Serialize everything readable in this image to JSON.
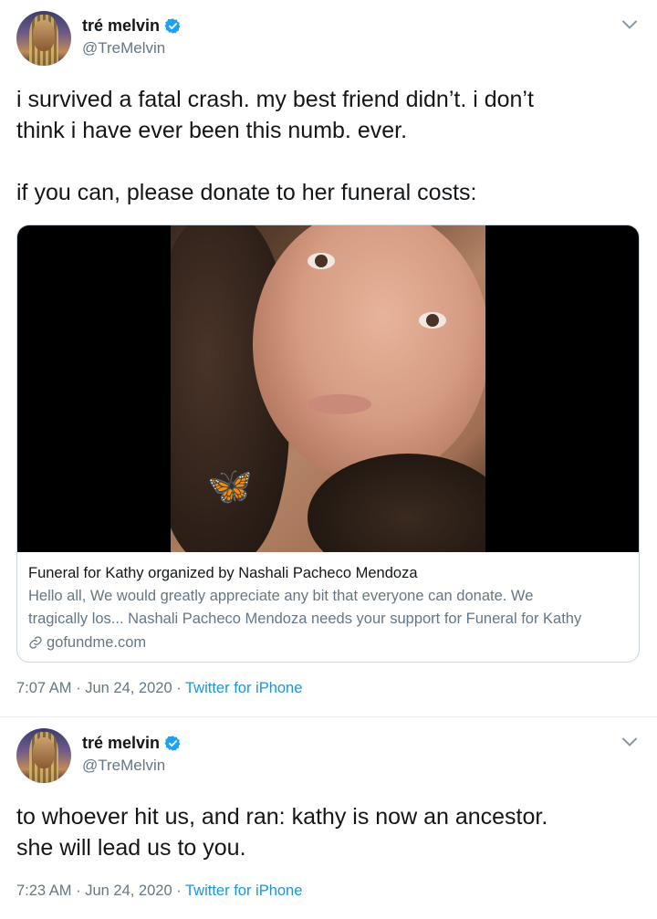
{
  "tweets": [
    {
      "author": {
        "name": "tré melvin",
        "handle": "@TreMelvin",
        "verified": true
      },
      "text": [
        "i survived a fatal crash. my best friend didn’t. i don’t",
        "think i have ever been this numb. ever.",
        "",
        "if you can, please donate to her funeral costs:"
      ],
      "card": {
        "title": "Funeral for Kathy organized by Nashali Pacheco Mendoza",
        "description_line1": "Hello all,   We would greatly appreciate any bit that everyone can donate. We",
        "description_line2": "tragically los... Nashali Pacheco Mendoza needs your support for Funeral for Kathy",
        "domain": "gofundme.com"
      },
      "time": "7:07 AM",
      "date": "Jun 24, 2020",
      "source": "Twitter for iPhone"
    },
    {
      "author": {
        "name": "tré melvin",
        "handle": "@TreMelvin",
        "verified": true
      },
      "text": [
        "to whoever hit us, and ran: kathy is now an ancestor.",
        "she will lead us to you."
      ],
      "time": "7:23 AM",
      "date": "Jun 24, 2020",
      "source": "Twitter for iPhone"
    }
  ],
  "separator": " · ",
  "colors": {
    "link": "#1b95e0",
    "secondary": "#657786",
    "border": "#ccd6dd",
    "verified": "#1da1f2"
  },
  "icons": [
    "verified-badge-icon",
    "chevron-down-icon",
    "link-icon"
  ]
}
